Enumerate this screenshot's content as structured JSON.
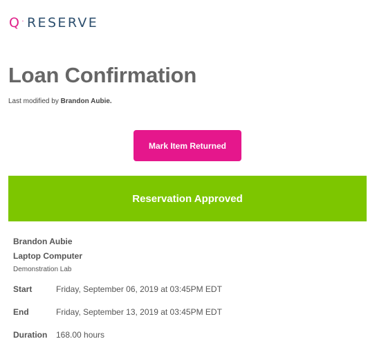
{
  "logo": {
    "q": "Q",
    "separator": "·",
    "brand": "RESERVE"
  },
  "page": {
    "title": "Loan Confirmation",
    "last_modified_prefix": "Last modified by",
    "last_modified_by": "Brandon Aubie."
  },
  "actions": {
    "mark_returned_label": "Mark Item Returned"
  },
  "status": {
    "label": "Reservation Approved",
    "color": "#7dc600"
  },
  "reservation": {
    "user": "Brandon Aubie",
    "item": "Laptop Computer",
    "location": "Demonstration Lab",
    "fields": {
      "start_label": "Start",
      "start_value": "Friday, September 06, 2019 at 03:45PM EDT",
      "end_label": "End",
      "end_value": "Friday, September 13, 2019 at 03:45PM EDT",
      "duration_label": "Duration",
      "duration_value": "168.00 hours"
    }
  },
  "colors": {
    "accent": "#e5178c",
    "brand_text": "#2d4f6e",
    "approved": "#7dc600"
  }
}
